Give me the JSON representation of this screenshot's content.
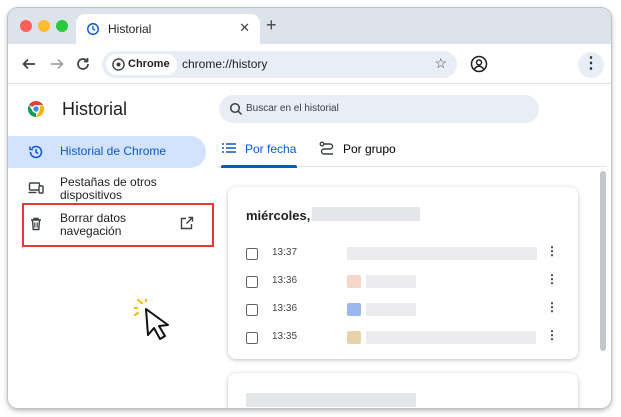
{
  "tab": {
    "title": "Historial",
    "close": "✕"
  },
  "new_tab": "+",
  "omnibox": {
    "chip": "Chrome",
    "url": "chrome://history"
  },
  "page": {
    "title": "Historial"
  },
  "search": {
    "placeholder": "Buscar en el historial"
  },
  "sidebar": {
    "items": [
      {
        "label": "Historial de Chrome",
        "icon": "history-icon",
        "active": true
      },
      {
        "label": "Pestañas de otros dispositivos",
        "icon": "devices-icon",
        "active": false
      },
      {
        "label": "Borrar datos navegación",
        "icon": "trash-icon",
        "active": false
      }
    ]
  },
  "history_tabs": [
    {
      "label": "Por fecha",
      "icon": "list-icon",
      "active": true
    },
    {
      "label": "Por grupo",
      "icon": "journeys-icon",
      "active": false
    }
  ],
  "card": {
    "date": "miércoles,",
    "entries": [
      {
        "time": "13:37"
      },
      {
        "time": "13:36"
      },
      {
        "time": "13:36"
      },
      {
        "time": "13:35"
      }
    ]
  },
  "colors": {
    "accent": "#0b57d0",
    "active_bg": "#d3e3fd",
    "highlight": "#e53935",
    "cursor_burst": "#f5b800"
  }
}
